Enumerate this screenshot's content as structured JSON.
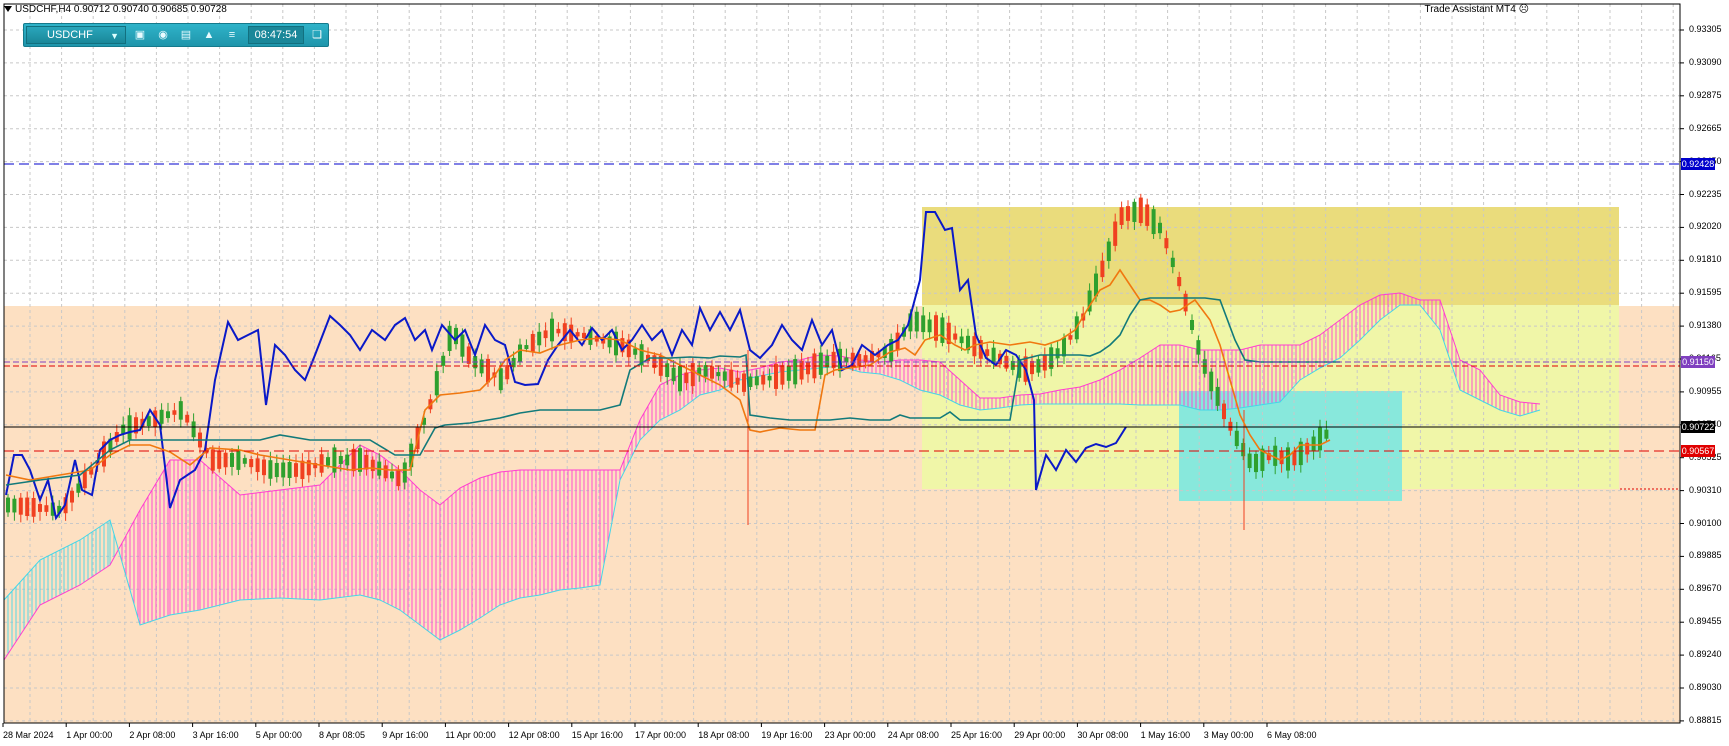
{
  "header": {
    "symbol_timeframe": "USDCHF,H4",
    "ohlc": "0.90712 0.90740 0.90685 0.90728",
    "trade_assistant": "Trade Assistant MT4"
  },
  "toolbar": {
    "symbol": "USDCHF",
    "time": "08:47:54",
    "icons": [
      "camera-icon",
      "eye-icon",
      "calendar-icon",
      "alert-bell-icon",
      "menu-icon",
      "window-icon"
    ]
  },
  "price_axis": [
    "0.93305",
    "0.93090",
    "0.92875",
    "0.92665",
    "0.92450",
    "0.92235",
    "0.92020",
    "0.91810",
    "0.91595",
    "0.91380",
    "0.91165",
    "0.90955",
    "0.90740",
    "0.90525",
    "0.90310",
    "0.90100",
    "0.89885",
    "0.89670",
    "0.89455",
    "0.89240",
    "0.89030",
    "0.88815"
  ],
  "price_tags": {
    "blue_line": "0.92428",
    "purple_line": "0.91150",
    "current_price": "0.90722",
    "red_line": "0.90567"
  },
  "time_axis": [
    "28 Mar 2024",
    "1 Apr 00:00",
    "2 Apr 08:00",
    "3 Apr 16:00",
    "5 Apr 00:00",
    "8 Apr 08:05",
    "9 Apr 16:00",
    "11 Apr 00:00",
    "12 Apr 08:00",
    "15 Apr 16:00",
    "17 Apr 00:00",
    "18 Apr 08:00",
    "19 Apr 16:00",
    "23 Apr 00:00",
    "24 Apr 08:00",
    "25 Apr 16:00",
    "29 Apr 00:00",
    "30 Apr 08:00",
    "1 May 16:00",
    "3 May 00:00",
    "6 May 08:00"
  ],
  "colors": {
    "zone_orange": "#fde0c2",
    "zone_yellow": "#f0f6a8",
    "zone_gold": "#eadc7c",
    "zone_cyan": "#88e8dc",
    "blue_line": "#0000cc",
    "purple_line": "#7f3fbf",
    "red_line": "#e00000",
    "tenkan": "#0a19c8",
    "kijun": "#f07810",
    "chikou": "#127a7a",
    "cloud_bull": "#ff3fd0",
    "cloud_bear": "#45d6e8",
    "bull_candle": "#2ea02e",
    "bear_candle": "#f04020"
  }
}
